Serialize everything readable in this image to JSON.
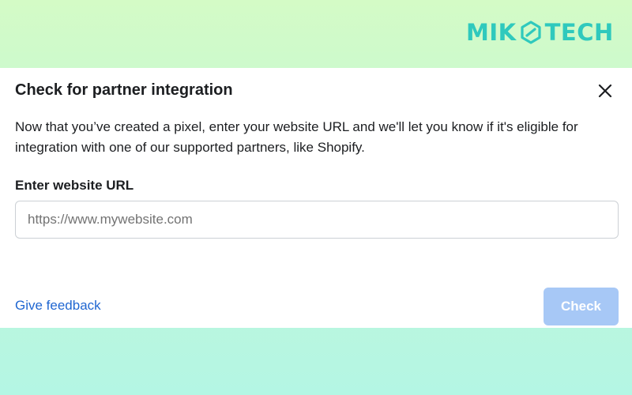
{
  "brand": {
    "left_text": "MIK",
    "right_text": "TECH",
    "icon": "hexagon-logo-icon",
    "color": "#2fc9bd"
  },
  "dialog": {
    "title": "Check for partner integration",
    "close_icon": "close-icon",
    "description": "Now that you’ve created a pixel, enter your website URL and we'll let you know if it's eligible for integration with one of our supported partners, like Shopify.",
    "url_field": {
      "label": "Enter website URL",
      "value": "",
      "placeholder": "https://www.mywebsite.com"
    },
    "feedback_link": "Give feedback",
    "check_button": {
      "label": "Check",
      "enabled": false
    }
  },
  "colors": {
    "link": "#1f66d1",
    "button_disabled": "#a7c8f6",
    "text": "#1c1e21"
  }
}
